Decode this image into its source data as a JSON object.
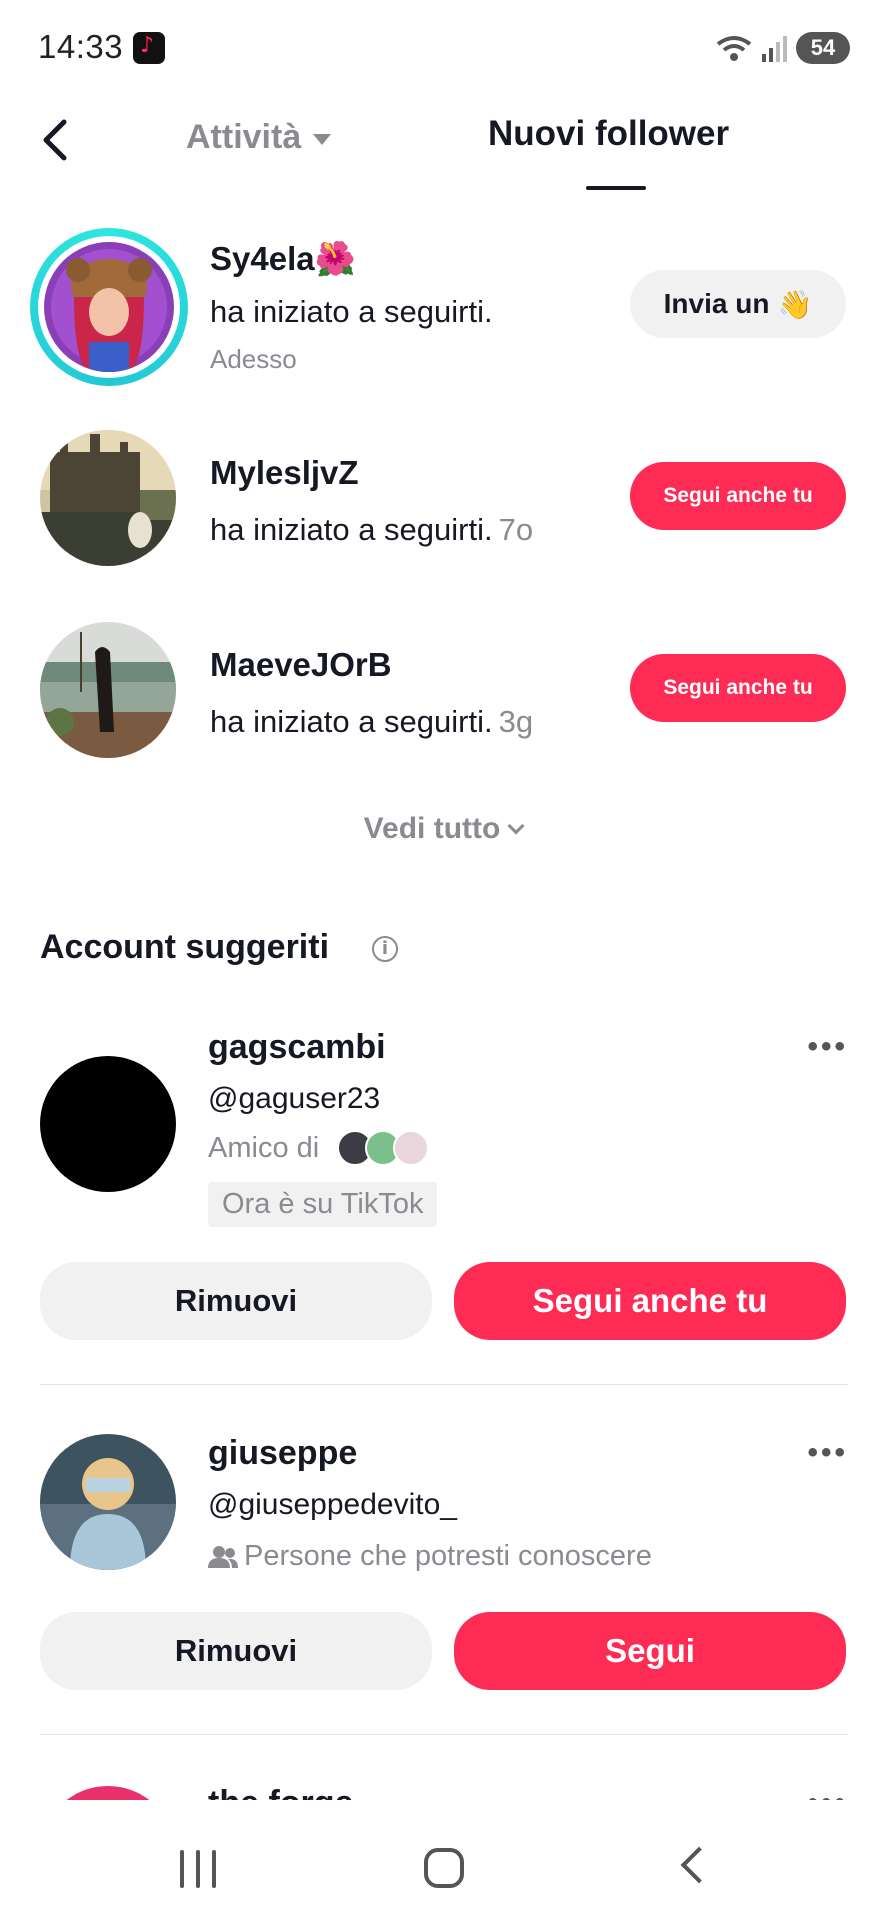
{
  "status_bar": {
    "time": "14:33",
    "battery": "54"
  },
  "header": {
    "tab_activity": "Attività",
    "tab_new_followers": "Nuovi follower"
  },
  "followers": [
    {
      "name": "Sy4ela",
      "name_emoji": "🌺",
      "text": "ha iniziato a seguirti.",
      "time": "Adesso",
      "button": "Invia un",
      "button_emoji": "👋"
    },
    {
      "name": "MylesljvZ",
      "text": "ha iniziato a seguirti.",
      "time": "7o",
      "button": "Segui anche tu"
    },
    {
      "name": "MaeveJOrB",
      "text": "ha iniziato a seguirti.",
      "time": "3g",
      "button": "Segui anche tu"
    }
  ],
  "see_all": "Vedi tutto",
  "suggested": {
    "title": "Account suggeriti",
    "accounts": [
      {
        "name": "gagscambi",
        "handle": "@gaguser23",
        "meta": "Amico di",
        "tag": "Ora è su TikTok",
        "remove": "Rimuovi",
        "follow": "Segui anche tu"
      },
      {
        "name": "giuseppe",
        "handle": "@giuseppedevito_",
        "meta": "Persone che potresti conoscere",
        "remove": "Rimuovi",
        "follow": "Segui"
      },
      {
        "name": "the forge"
      }
    ]
  },
  "colors": {
    "accent": "#fe2c55",
    "text": "#161823",
    "muted": "#8a8b91",
    "grey_button": "#f1f1f2"
  }
}
